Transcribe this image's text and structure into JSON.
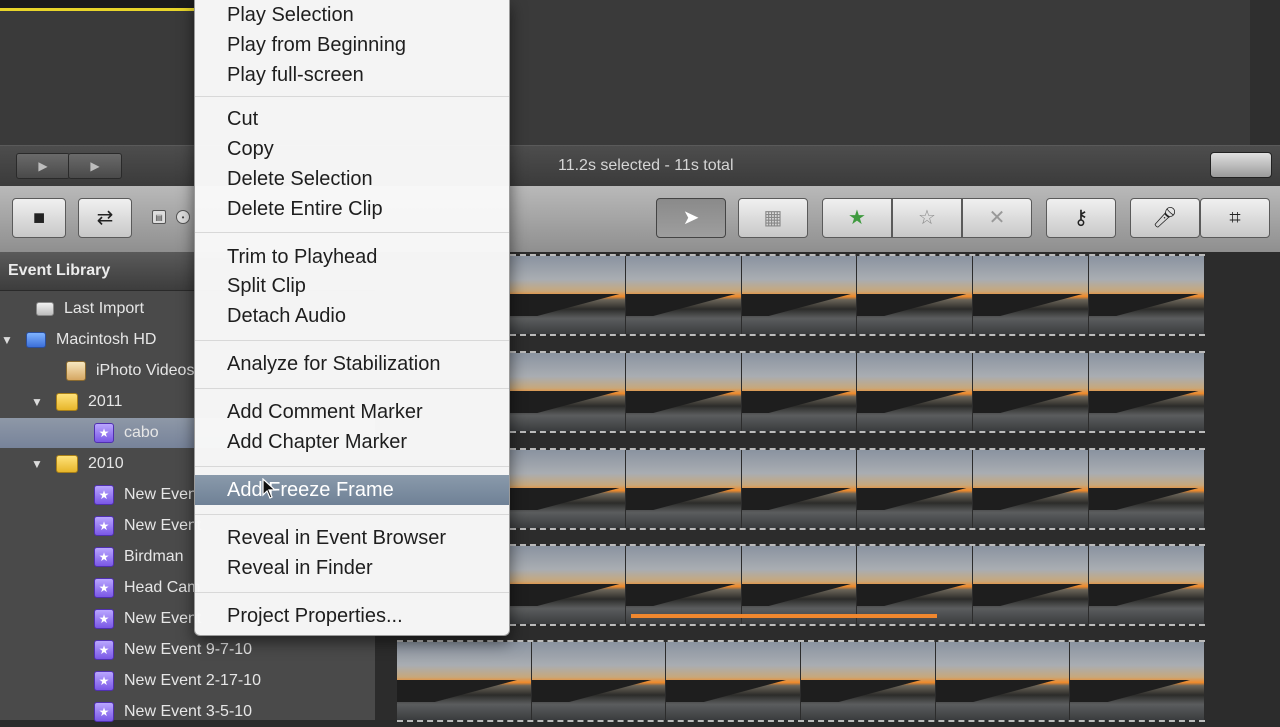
{
  "context_menu": {
    "groups": [
      [
        "Play Selection",
        "Play from Beginning",
        "Play full-screen"
      ],
      [
        "Cut",
        "Copy",
        "Delete Selection",
        "Delete Entire Clip"
      ],
      [
        "Trim to Playhead",
        "Split Clip",
        "Detach Audio"
      ],
      [
        "Analyze for Stabilization"
      ],
      [
        "Add Comment Marker",
        "Add Chapter Marker"
      ],
      [
        "Add Freeze Frame"
      ],
      [
        "Reveal in Event Browser",
        "Reveal in Finder"
      ],
      [
        "Project Properties..."
      ]
    ],
    "highlighted_item": "Add Freeze Frame"
  },
  "status": {
    "selection_text": "11.2s selected - 11s total"
  },
  "sidebar": {
    "header": "Event Library",
    "items": [
      {
        "label": "Last Import",
        "icon": "last-import-icon"
      },
      {
        "label": "Macintosh HD",
        "icon": "hard-drive-icon",
        "expanded": true
      },
      {
        "label": "iPhoto Videos",
        "icon": "iphoto-icon"
      },
      {
        "label": "2011",
        "icon": "folder-icon",
        "expanded": true
      },
      {
        "label": "cabo",
        "icon": "event-star-icon",
        "selected": true
      },
      {
        "label": "2010",
        "icon": "folder-icon",
        "expanded": true
      },
      {
        "label": "New Event",
        "icon": "event-star-icon"
      },
      {
        "label": "New Event",
        "icon": "event-star-icon"
      },
      {
        "label": "Birdman",
        "icon": "event-star-icon"
      },
      {
        "label": "Head Cam",
        "icon": "event-star-icon"
      },
      {
        "label": "New Event",
        "icon": "event-star-icon"
      },
      {
        "label": "New Event 9-7-10",
        "icon": "event-star-icon"
      },
      {
        "label": "New Event 2-17-10",
        "icon": "event-star-icon"
      },
      {
        "label": "New Event 3-5-10",
        "icon": "event-star-icon"
      }
    ]
  },
  "toolbar": {
    "tools": [
      "arrow-select-icon",
      "add-to-project-icon",
      "favorite-star-icon",
      "unmark-star-icon",
      "reject-x-icon",
      "keyword-key-icon",
      "voiceover-mic-icon",
      "crop-icon"
    ]
  },
  "colors": {
    "accent_highlight": "#7a8ca0",
    "selection_orange": "#f0872e"
  }
}
